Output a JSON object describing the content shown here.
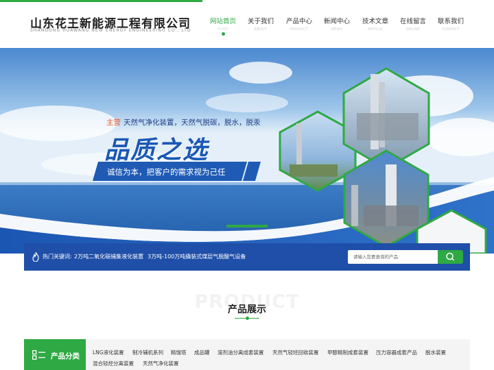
{
  "header": {
    "company_cn": "山东花王新能源工程有限公司",
    "company_en": "SHANDONG HUAWANG NEW ENERGY ENGINEERING CO., LTD"
  },
  "nav": [
    {
      "cn": "网站首页",
      "en": "HOME"
    },
    {
      "cn": "关于我们",
      "en": "ABOUT"
    },
    {
      "cn": "产品中心",
      "en": "PRODUCT"
    },
    {
      "cn": "新闻中心",
      "en": "NEWS"
    },
    {
      "cn": "技术文章",
      "en": "ARTICLE"
    },
    {
      "cn": "在线留言",
      "en": "ONLINE"
    },
    {
      "cn": "联系我们",
      "en": "CONTACT"
    }
  ],
  "banner": {
    "main_label": "主营",
    "main_text": "天然气净化装置，天然气脱碳，脱水，脱汞",
    "slogan": "品质之选",
    "tagline": "诚信为本，把客户的需求视为己任"
  },
  "search": {
    "hot_label": "热门关键词:",
    "keywords": [
      "2万吨二氧化碳捕集液化装置",
      "3万吨-100万吨撬装式煤层气脱酸气设备"
    ],
    "placeholder": "请输入您要查询的产品"
  },
  "products": {
    "bg_title": "PRODUCT",
    "title": "产品展示",
    "category_label": "产品分类",
    "categories_row1": [
      "LNG液化装置",
      "制冷辅机系列",
      "精馏塔",
      "成品罐",
      "溶剂油分离成套装置",
      "天然气轻烃回收装置",
      "甲醇精制成套装置",
      "压力容器成套产品",
      "脱水装置"
    ],
    "categories_row2": [
      "混合轻烃分离装置",
      "天然气净化装置"
    ]
  },
  "colors": {
    "accent": "#2fa944",
    "brand_blue": "#1f4fa8"
  }
}
